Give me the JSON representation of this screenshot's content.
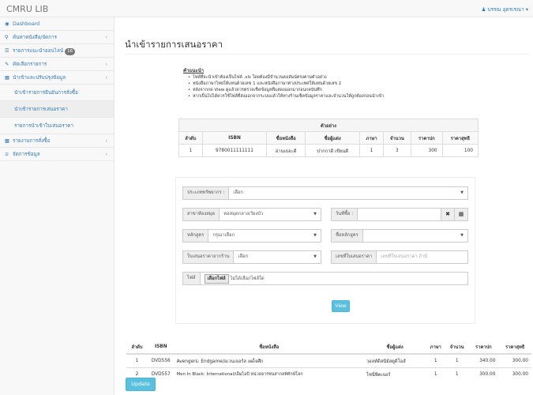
{
  "app": {
    "brand": "CMRU LIB",
    "user_name": "บรรณ อุดรเรณา"
  },
  "sidebar": {
    "items": [
      {
        "label": "Dashboard",
        "icon": "dashboard-icon",
        "has_chevron": false
      },
      {
        "label": "ค้นหาหนังสือ/จัดการ",
        "icon": "search-icon",
        "has_chevron": true
      },
      {
        "label": "รายการแนะนำออนไลน์",
        "icon": "list-icon",
        "badge": "16",
        "has_chevron": false
      },
      {
        "label": "คัดเลือกรายการ",
        "icon": "edit-icon",
        "has_chevron": true
      },
      {
        "label": "นำเข้าและปรับปรุงข้อมูล",
        "icon": "table-icon",
        "has_chevron": true
      },
      {
        "label": "นำเข้ารายการยืนยันการสั่งซื้อ",
        "sub": true
      },
      {
        "label": "นำเข้ารายการเสนอราคา",
        "sub": true
      },
      {
        "label": "รายการนำเข้าใบเสนอราคา",
        "sub": true
      },
      {
        "label": "รายงานการสั่งซื้อ",
        "icon": "chart-icon",
        "has_chevron": true
      },
      {
        "label": "จัดการข้อมูล",
        "icon": "settings-icon",
        "has_chevron": true
      }
    ]
  },
  "page": {
    "title": "นำเข้ารายการเสนอราคา"
  },
  "instructions": {
    "title": "คำแนะนำ",
    "items": [
      "ไฟล์ที่จะนำเข้าต้องเป็นไฟล์ .xls โดยต้องมีจำนวนคอลัมน์ตรงตามตัวอย่าง",
      "หนังสือภาษาไทยให้แทนด้วยเลข 1 และหนังสือภาษาต่างประเทศให้แทนด้วยเลข 2",
      "หลังจากกด View ดูแล้วควรตรวจเช็คข้อมูลที่แสดงออกมาก่อนกดบันทึก",
      "หากเป็นไปได้ควรใช้ไฟล์ที่ส่งออกจากระบบแล้วให้ทางร้านเช็คข้อมูลราคาและจำนวนให้ถูกต้องก่อนนำเข้า"
    ]
  },
  "example_table": {
    "caption": "ตัวอย่าง",
    "headers": [
      "ลำดับ",
      "ISBN",
      "ชื่อหนังสือ",
      "ชื่อผู้แต่ง",
      "ภาษา",
      "จำนวน",
      "ราคาปก",
      "ราคาสุทธิ"
    ],
    "row": [
      "1",
      "9780011111111",
      "อ่านเธอะดี",
      "ปากกาดี เขียนดี",
      "1",
      "3",
      "300",
      "100"
    ]
  },
  "form": {
    "resource_type": {
      "label": "ประเภททรัพยากร :",
      "value": "เลือก"
    },
    "branch": {
      "label": "สาขาห้องสมุด",
      "value": "หอสมุดกลางเวียงบัว"
    },
    "purchase_date": {
      "label": "วันที่ซื้อ :",
      "value": ""
    },
    "course": {
      "label": "หลักสูตร",
      "value": "กรุณาเลือก"
    },
    "course_name": {
      "label": "ชื่อหลักสูตร",
      "value": ""
    },
    "quote_from": {
      "label": "ใบเสนอราคาจากร้าน",
      "value": "เลือก"
    },
    "quote_number": {
      "label": "เลขที่ใบเสนอราคา",
      "placeholder": "เลขที่ใบเสนอราคา ถ้ามี"
    },
    "file": {
      "label": "ไฟล์",
      "button": "เลือกไฟล์",
      "status": "ไม่ได้เลือกไฟล์ใด"
    },
    "view_button": "View",
    "clear_icon": "close-icon",
    "calendar_icon": "calendar-icon"
  },
  "results": {
    "headers": [
      "ลำดับ",
      "ISBN",
      "ชื่อหนังสือ",
      "ชื่อผู้แต่ง",
      "ภาษา",
      "จำนวน",
      "ราคาปก",
      "ราคาสุทธิ"
    ],
    "rows": [
      [
        "1",
        "DVD556",
        "Avengers: Endgame/อเวนเจอร์ส เผด็จศึก",
        "วอลท์ดิสนีย์สตูดิโอส์",
        "1",
        "1",
        "340.00",
        "300.00"
      ],
      [
        "2",
        "DVD557",
        "Men In Black: International/เอ็มไอบี หน่วยจารชนสากลพิทักษ์โลก",
        "โซนี่พิคเจอร์",
        "1",
        "1",
        "300.00",
        "300.00"
      ]
    ]
  },
  "update_button": "Update"
}
